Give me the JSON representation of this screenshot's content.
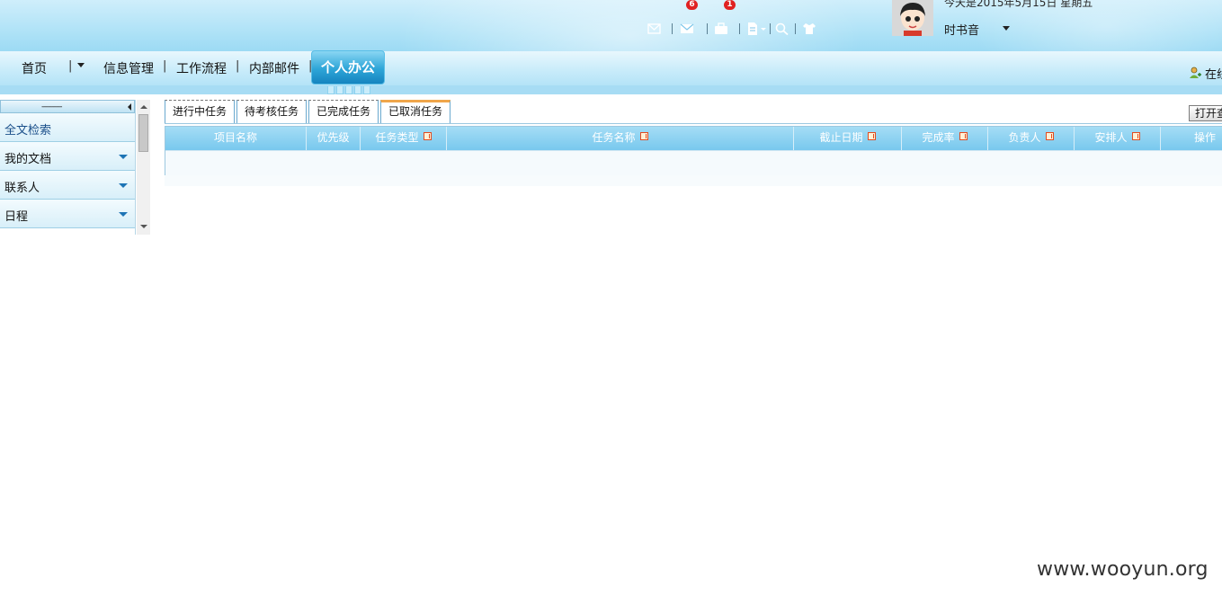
{
  "header": {
    "date_text": "今天是2015年5月15日  星期五",
    "user_name": "时书音",
    "online_label": "在线",
    "badges": {
      "mail": "6",
      "briefcase": "1"
    },
    "icons": [
      "check-mail-icon",
      "envelope-icon",
      "briefcase-icon",
      "document-icon",
      "search-icon",
      "shirt-icon"
    ]
  },
  "nav": {
    "home": "首页",
    "info_mgmt": "信息管理",
    "workflow": "工作流程",
    "internal_mail": "内部邮件",
    "personal_office": "个人办公"
  },
  "sidebar": {
    "collapse_dots": "----------",
    "items": [
      {
        "label": "全文检索"
      },
      {
        "label": "我的文档"
      },
      {
        "label": "联系人"
      },
      {
        "label": "日程"
      }
    ]
  },
  "tabs": [
    "进行中任务",
    "待考核任务",
    "已完成任务",
    "已取消任务"
  ],
  "open_button": "打开查询",
  "table": {
    "columns": [
      "项目名称",
      "优先级",
      "任务类型",
      "任务名称",
      "截止日期",
      "完成率",
      "负责人",
      "安排人",
      "操作"
    ],
    "rows": []
  },
  "watermark": "www.wooyun.org",
  "colors": {
    "header_blue": "#8fd4f2",
    "grid_head": "#78c8ee",
    "active_tab_accent": "#f0a64a",
    "badge_red": "#e02222"
  }
}
